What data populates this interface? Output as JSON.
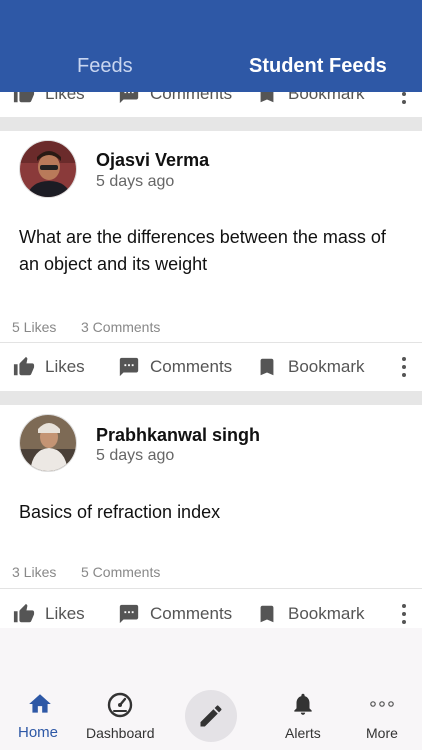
{
  "header": {
    "tabs": [
      {
        "label": "Feeds"
      },
      {
        "label": "Student Feeds"
      }
    ]
  },
  "actions": {
    "likes": "Likes",
    "comments": "Comments",
    "bookmark": "Bookmark"
  },
  "posts": [
    {
      "author": "Ojasvi Verma",
      "time": "5 days ago",
      "text": "What are the differences between the mass of an object and its weight",
      "likes": "5 Likes",
      "comments": "3 Comments"
    },
    {
      "author": "Prabhkanwal singh",
      "time": "5 days ago",
      "text": "Basics of refraction index",
      "likes": "3 Likes",
      "comments": "5 Comments"
    }
  ],
  "bottom_nav": {
    "items": [
      {
        "label": "Home",
        "icon": "home-icon"
      },
      {
        "label": "Dashboard",
        "icon": "speedometer-icon"
      },
      {
        "label": "",
        "icon": "pencil-icon"
      },
      {
        "label": "Alerts",
        "icon": "bell-icon"
      },
      {
        "label": "More",
        "icon": "more-dots-icon"
      }
    ]
  },
  "colors": {
    "header": "#2e58a6",
    "active": "#2e58a6"
  }
}
